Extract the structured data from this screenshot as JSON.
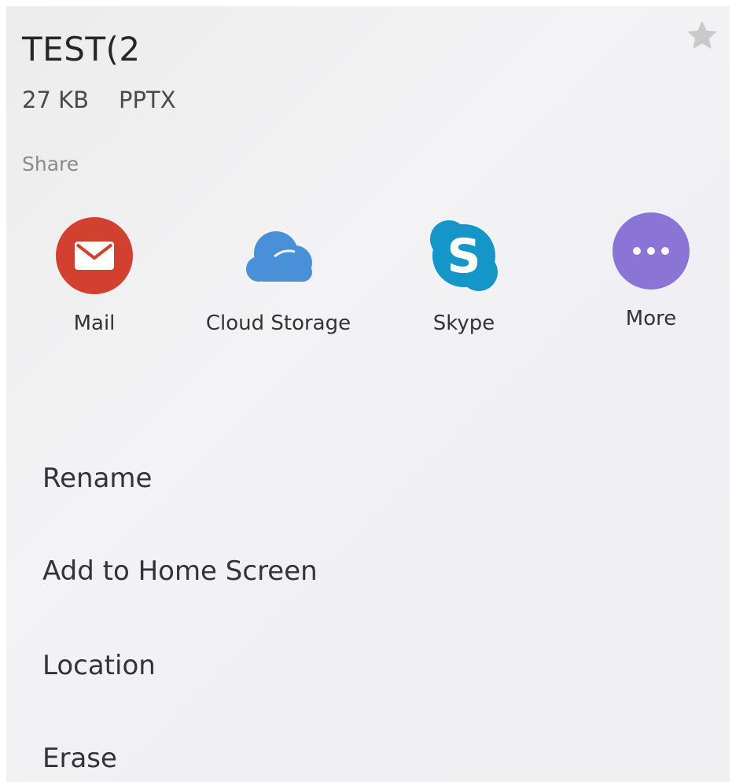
{
  "file": {
    "title": "TEST(2",
    "size": "27 KB",
    "type": "PPTX"
  },
  "share": {
    "label": "Share",
    "items": [
      {
        "label": "Mail",
        "icon": "mail-icon",
        "color": "#d2402f"
      },
      {
        "label": "Cloud Storage",
        "icon": "cloud-icon",
        "color": "#4a90d9"
      },
      {
        "label": "Skype",
        "icon": "skype-icon",
        "color": "#1496c8"
      },
      {
        "label": "More",
        "icon": "more-icon",
        "color": "#8a74d6"
      }
    ]
  },
  "menu": {
    "items": [
      {
        "label": "Rename"
      },
      {
        "label": "Add to Home Screen"
      },
      {
        "label": "Location"
      },
      {
        "label": "Erase"
      }
    ]
  },
  "colors": {
    "star": "#c8c8c8",
    "text_primary": "#262626",
    "text_secondary": "#8a8a8a"
  }
}
